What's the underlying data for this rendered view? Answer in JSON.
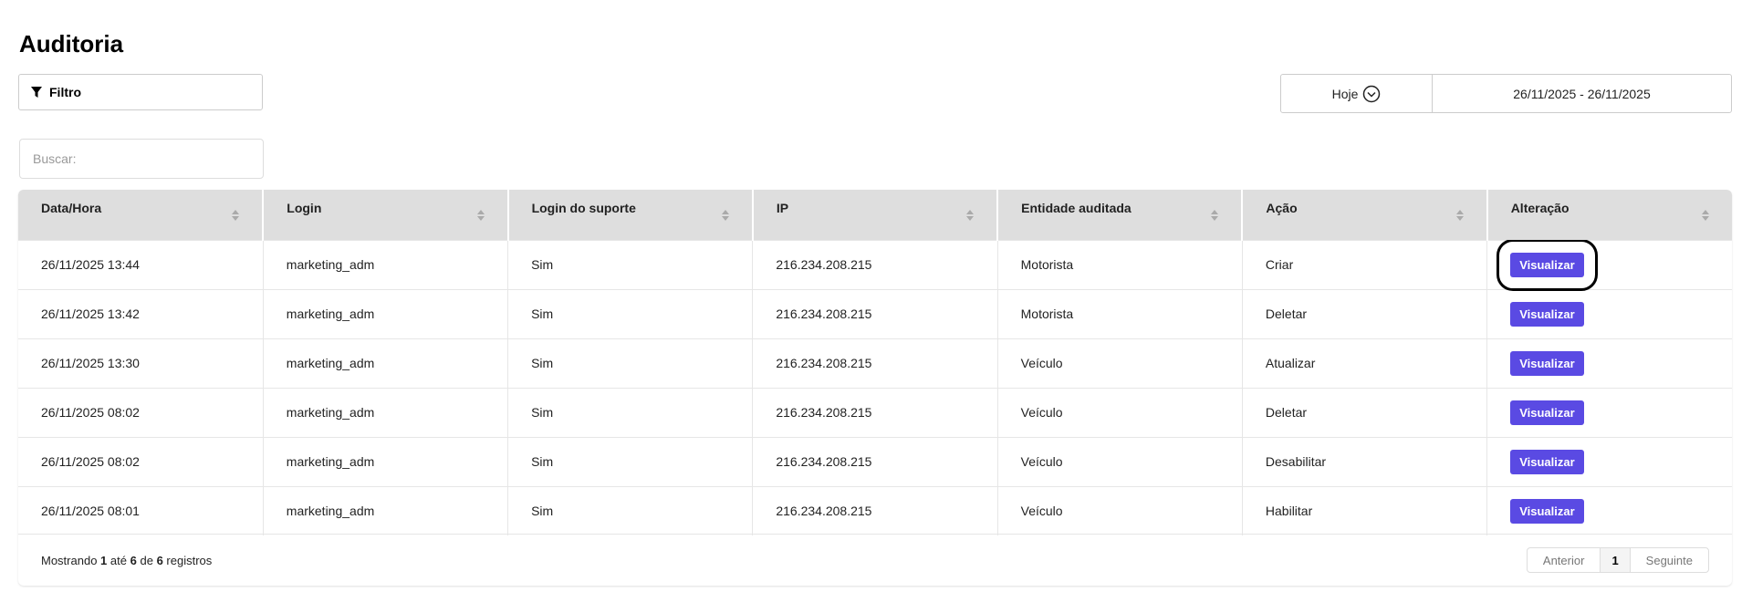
{
  "title": "Auditoria",
  "filter_label": "Filtro",
  "period": {
    "preset": "Hoje",
    "range": "26/11/2025 - 26/11/2025"
  },
  "search": {
    "placeholder": "Buscar:",
    "value": ""
  },
  "columns": [
    "Data/Hora",
    "Login",
    "Login do suporte",
    "IP",
    "Entidade auditada",
    "Ação",
    "Alteração"
  ],
  "rows": [
    [
      "26/11/2025 13:44",
      "marketing_adm",
      "Sim",
      "216.234.208.215",
      "Motorista",
      "Criar",
      "Visualizar"
    ],
    [
      "26/11/2025 13:42",
      "marketing_adm",
      "Sim",
      "216.234.208.215",
      "Motorista",
      "Deletar",
      "Visualizar"
    ],
    [
      "26/11/2025 13:30",
      "marketing_adm",
      "Sim",
      "216.234.208.215",
      "Veículo",
      "Atualizar",
      "Visualizar"
    ],
    [
      "26/11/2025 08:02",
      "marketing_adm",
      "Sim",
      "216.234.208.215",
      "Veículo",
      "Deletar",
      "Visualizar"
    ],
    [
      "26/11/2025 08:02",
      "marketing_adm",
      "Sim",
      "216.234.208.215",
      "Veículo",
      "Desabilitar",
      "Visualizar"
    ],
    [
      "26/11/2025 08:01",
      "marketing_adm",
      "Sim",
      "216.234.208.215",
      "Veículo",
      "Habilitar",
      "Visualizar"
    ]
  ],
  "footer": {
    "prefix": "Mostrando",
    "from": "1",
    "to_word": "até",
    "to": "6",
    "of_word": "de",
    "total": "6",
    "suffix": "registros"
  },
  "pagination": {
    "prev": "Anterior",
    "current": "1",
    "next": "Seguinte"
  },
  "colors": {
    "accent": "#5a4ae3",
    "header_bg": "#dedede"
  }
}
